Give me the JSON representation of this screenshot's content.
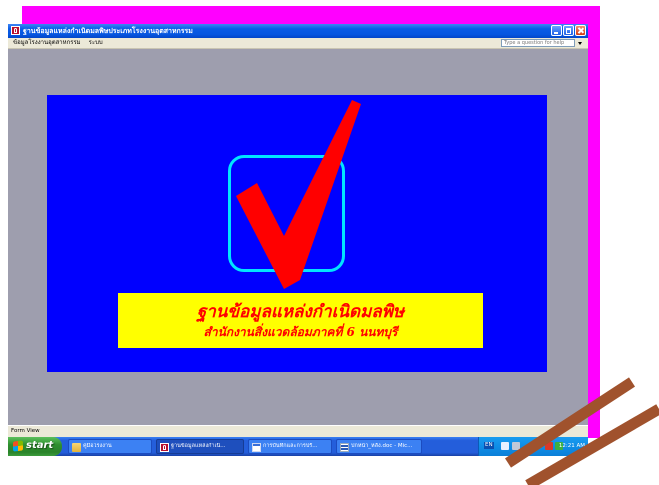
{
  "window": {
    "title": "ฐานข้อมูลแหล่งกำเนิดมลพิษประเภทโรงงานอุตสาหกรรม",
    "app_icon": "access-app-icon",
    "controls": [
      "minimize-icon",
      "maximize-icon",
      "close-icon"
    ]
  },
  "menu": {
    "items": [
      {
        "label": "ข้อมูลโรงงานอุตสาหกรรม"
      },
      {
        "label": "ระบบ"
      }
    ],
    "help_placeholder": "Type a question for help",
    "help_dropdown_icon": "chevron-down-icon"
  },
  "form": {
    "logo_icon": "checkmark-icon",
    "banner": {
      "title": "ฐานข้อมูลแหล่งกำเนิดมลพิษ",
      "subtitle": "สำนักงานสิ่งแวดล้อมภาคที่ 6 นนทบุรี"
    }
  },
  "status_bar": {
    "text": "Form View"
  },
  "taskbar": {
    "start_label": "start",
    "start_icon": "windows-flag-icon",
    "tasks": [
      {
        "label": "คู่มือโรงงาน",
        "icon": "folder-icon",
        "active": false
      },
      {
        "label": "ฐานข้อมูลแหล่งกำเนิ...",
        "icon": "access-app-icon",
        "active": true
      },
      {
        "label": "การบันทึกและการปรั...",
        "icon": "window-icon",
        "active": false
      },
      {
        "label": "ปกหน้า_หลัง.doc - Mic...",
        "icon": "word-document-icon",
        "active": false
      }
    ],
    "tray": {
      "language": "EN",
      "icons": [
        "network-icon",
        "volume-icon",
        "security-icon",
        "messenger-icon"
      ],
      "time": "12:21 AM"
    }
  },
  "colors": {
    "backdrop": "#ff00ff",
    "title_bar": "#0a5ce6",
    "mdi_background": "#9e9eae",
    "form_background": "#0000ff",
    "logo_frame": "#00e5ff",
    "checkmark": "#ff0000",
    "banner_background": "#ffff00",
    "banner_text": "#ff0000",
    "taskbar": "#245edb",
    "start_button": "#2f8f2f",
    "decor_stripes": "#a0522d"
  }
}
